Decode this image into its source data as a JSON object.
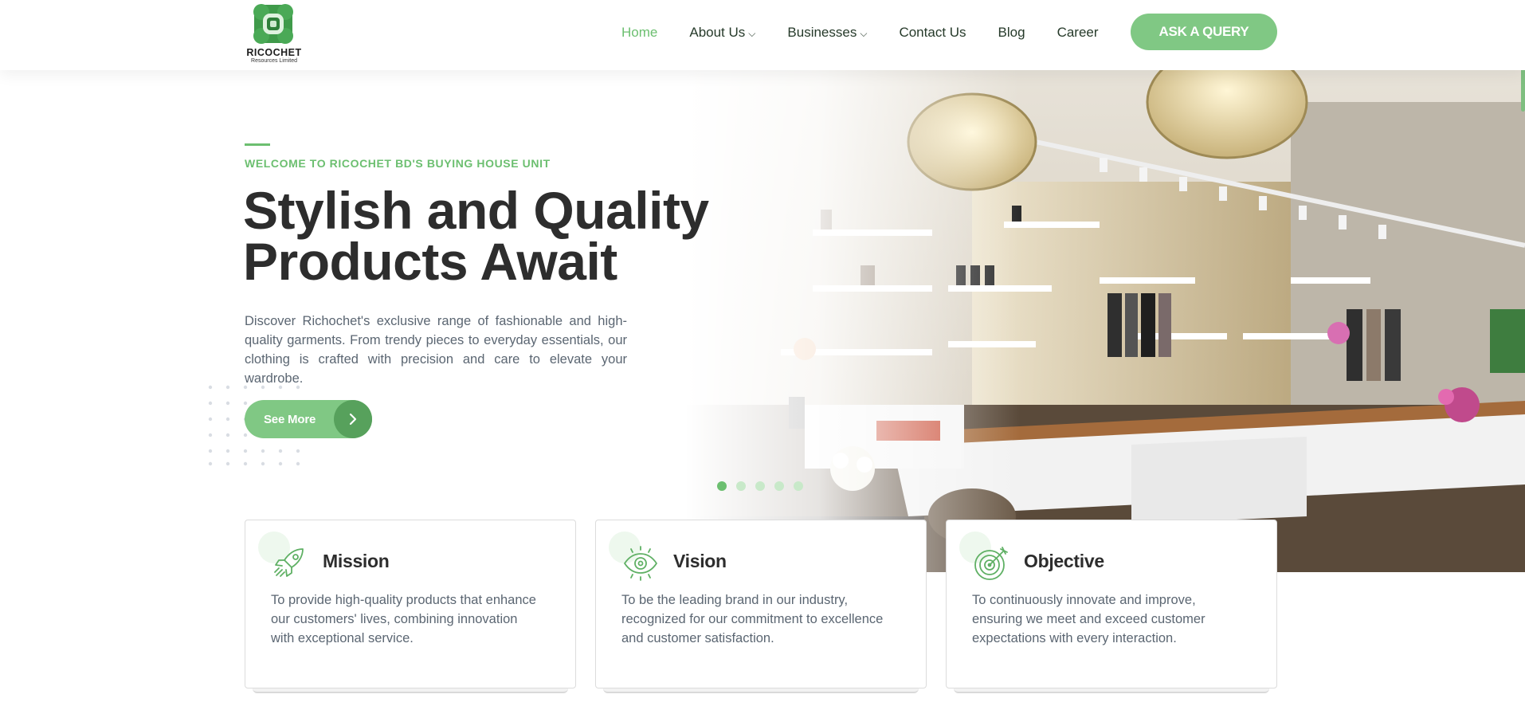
{
  "header": {
    "logo_name": "RICOCHET",
    "logo_sub": "Resources Limited",
    "nav": [
      {
        "label": "Home",
        "active": true,
        "has_dropdown": false
      },
      {
        "label": "About Us",
        "active": false,
        "has_dropdown": true
      },
      {
        "label": "Businesses",
        "active": false,
        "has_dropdown": true
      },
      {
        "label": "Contact Us",
        "active": false,
        "has_dropdown": false
      },
      {
        "label": "Blog",
        "active": false,
        "has_dropdown": false
      },
      {
        "label": "Career",
        "active": false,
        "has_dropdown": false
      }
    ],
    "cta_label": "ASK A QUERY"
  },
  "hero": {
    "kicker": "WELCOME TO RICOCHET BD'S BUYING HOUSE UNIT",
    "title": "Stylish and Quality Products Await",
    "description": "Discover Richochet's exclusive range of fashionable and high-quality garments. From trendy pieces to everyday essentials, our clothing is crafted with precision and care to elevate your wardrobe.",
    "button_label": "See More",
    "button_icon": "chevron-right-icon",
    "image": "boutique-store-interior",
    "slider": {
      "count": 5,
      "active_index": 0
    }
  },
  "cards": [
    {
      "title": "Mission",
      "icon": "rocket-icon",
      "text": "To provide high-quality products that enhance our customers' lives, combining innovation with exceptional service."
    },
    {
      "title": "Vision",
      "icon": "eye-icon",
      "text": "To be the leading brand in our industry, recognized for our commitment to excellence and customer satisfaction."
    },
    {
      "title": "Objective",
      "icon": "target-icon",
      "text": "To continuously innovate and improve, ensuring we meet and exceed customer expectations with every interaction."
    }
  ],
  "colors": {
    "accent": "#6cbf70",
    "button": "#80c884",
    "button_dark": "#57a15c",
    "heading": "#2d2d2d",
    "body_text": "#5b6672"
  }
}
